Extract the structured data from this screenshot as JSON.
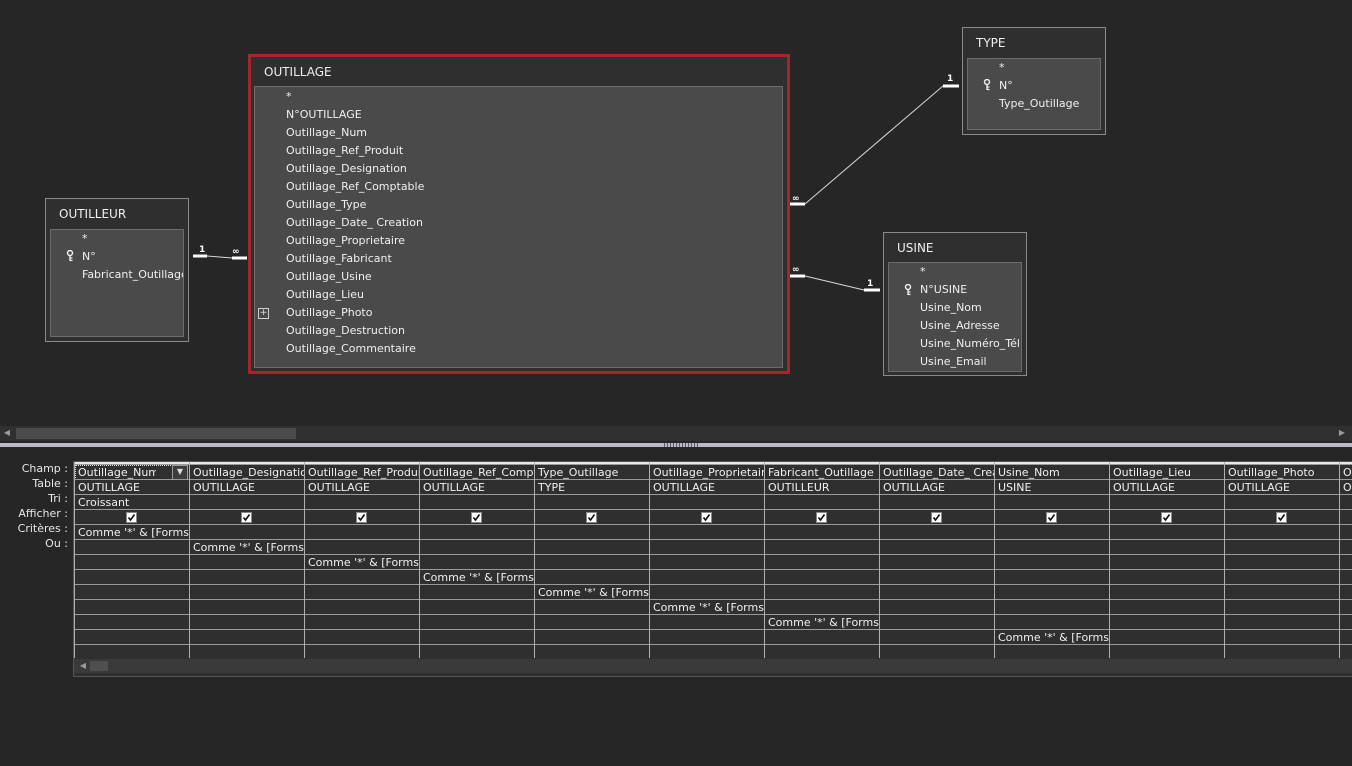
{
  "diagram": {
    "tables": {
      "outilleur": {
        "title": "OUTILLEUR",
        "fields": [
          "*",
          "N°",
          "Fabricant_Outillage"
        ],
        "key_field_index": 1
      },
      "outillage": {
        "title": "OUTILLAGE",
        "fields": [
          "*",
          "N°OUTILLAGE",
          "Outillage_Num",
          "Outillage_Ref_Produit",
          "Outillage_Designation",
          "Outillage_Ref_Comptable",
          "Outillage_Type",
          "Outillage_Date_ Creation",
          "Outillage_Proprietaire",
          "Outillage_Fabricant",
          "Outillage_Usine",
          "Outillage_Lieu",
          "Outillage_Photo",
          "Outillage_Destruction",
          "Outillage_Commentaire"
        ],
        "expandable_field_index": 12
      },
      "type": {
        "title": "TYPE",
        "fields": [
          "*",
          "N°",
          "Type_Outillage"
        ],
        "key_field_index": 1
      },
      "usine": {
        "title": "USINE",
        "fields": [
          "*",
          "N°USINE",
          "Usine_Nom",
          "Usine_Adresse",
          "Usine_Numéro_Tél",
          "Usine_Email"
        ],
        "key_field_index": 1
      }
    },
    "relationships": [
      {
        "from": "outilleur",
        "to": "outillage",
        "from_label": "1",
        "to_label": "∞"
      },
      {
        "from": "outillage",
        "to": "type",
        "from_label": "∞",
        "to_label": "1"
      },
      {
        "from": "outillage",
        "to": "usine",
        "from_label": "∞",
        "to_label": "1"
      }
    ]
  },
  "grid": {
    "row_labels": [
      "Champ :",
      "Table :",
      "Tri :",
      "Afficher :",
      "Critères :",
      "Ou :"
    ],
    "columns": [
      {
        "field": "Outillage_Num",
        "table": "OUTILLAGE",
        "sort": "Croissant",
        "show": true,
        "criteria_row": 0
      },
      {
        "field": "Outillage_Designatio",
        "table": "OUTILLAGE",
        "sort": "",
        "show": true,
        "criteria_row": 1
      },
      {
        "field": "Outillage_Ref_Produi",
        "table": "OUTILLAGE",
        "sort": "",
        "show": true,
        "criteria_row": 2
      },
      {
        "field": "Outillage_Ref_Compt",
        "table": "OUTILLAGE",
        "sort": "",
        "show": true,
        "criteria_row": 3
      },
      {
        "field": "Type_Outillage",
        "table": "TYPE",
        "sort": "",
        "show": true,
        "criteria_row": 4
      },
      {
        "field": "Outillage_Proprietaire",
        "table": "OUTILLAGE",
        "sort": "",
        "show": true,
        "criteria_row": 5
      },
      {
        "field": "Fabricant_Outillage",
        "table": "OUTILLEUR",
        "sort": "",
        "show": true,
        "criteria_row": 6
      },
      {
        "field": "Outillage_Date_ Creat",
        "table": "OUTILLAGE",
        "sort": "",
        "show": true,
        "criteria_row": null
      },
      {
        "field": "Usine_Nom",
        "table": "USINE",
        "sort": "",
        "show": true,
        "criteria_row": 7
      },
      {
        "field": "Outillage_Lieu",
        "table": "OUTILLAGE",
        "sort": "",
        "show": true,
        "criteria_row": null
      },
      {
        "field": "Outillage_Photo",
        "table": "OUTILLAGE",
        "sort": "",
        "show": true,
        "criteria_row": null
      },
      {
        "field": "O",
        "table": "O",
        "sort": "",
        "show": false,
        "criteria_row": null
      }
    ],
    "criteria_text": "Comme '*' & [Forms]![",
    "dropdown_icon": "chevron-down-icon"
  },
  "colors": {
    "selected_border": "#a3262a",
    "background": "#262626",
    "table_body": "#4a4a4a"
  }
}
